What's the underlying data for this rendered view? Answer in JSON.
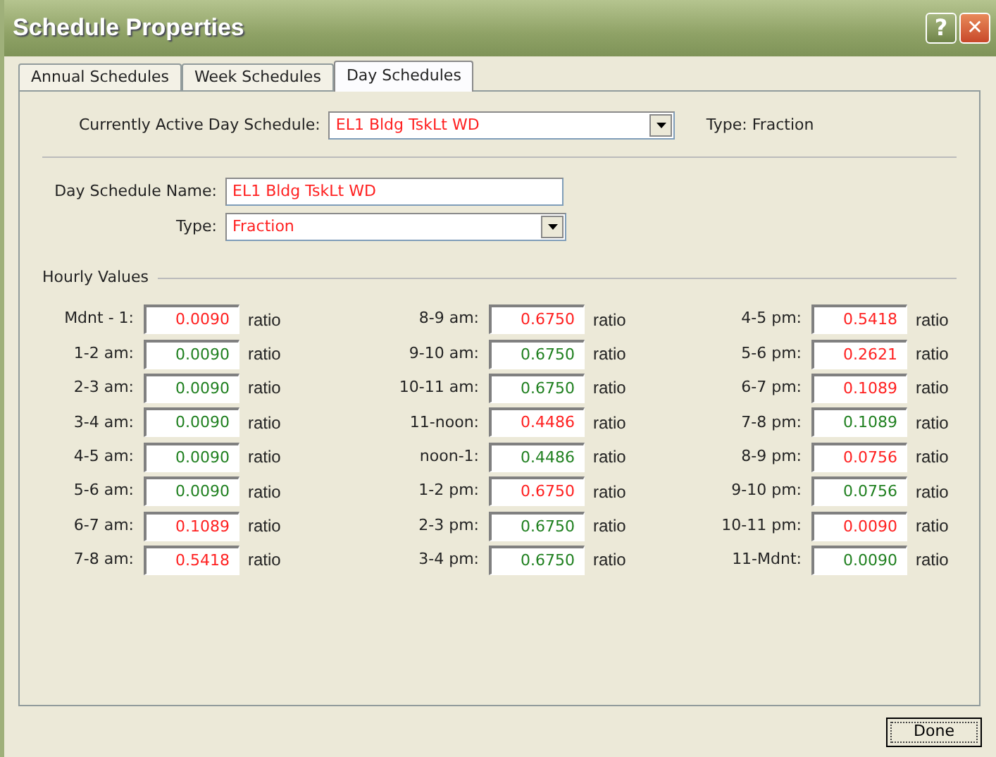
{
  "window": {
    "title": "Schedule Properties",
    "help_button": "?",
    "close_button": "✕"
  },
  "tabs": [
    {
      "label": "Annual Schedules",
      "selected": false
    },
    {
      "label": "Week Schedules",
      "selected": false
    },
    {
      "label": "Day Schedules",
      "selected": true
    }
  ],
  "active_schedule": {
    "label": "Currently Active Day Schedule:",
    "value": "EL1 Bldg TskLt WD",
    "type_text": "Type: Fraction"
  },
  "day_schedule_name": {
    "label": "Day Schedule Name:",
    "value": "EL1 Bldg TskLt WD"
  },
  "type": {
    "label": "Type:",
    "value": "Fraction"
  },
  "hourly_values": {
    "title": "Hourly Values",
    "columns": [
      [
        {
          "label": "Mdnt - 1:",
          "value": "0.0090",
          "unit": "ratio",
          "color": "#ff2020"
        },
        {
          "label": "1-2 am:",
          "value": "0.0090",
          "unit": "ratio",
          "color": "#208020"
        },
        {
          "label": "2-3 am:",
          "value": "0.0090",
          "unit": "ratio",
          "color": "#208020"
        },
        {
          "label": "3-4 am:",
          "value": "0.0090",
          "unit": "ratio",
          "color": "#208020"
        },
        {
          "label": "4-5 am:",
          "value": "0.0090",
          "unit": "ratio",
          "color": "#208020"
        },
        {
          "label": "5-6 am:",
          "value": "0.0090",
          "unit": "ratio",
          "color": "#208020"
        },
        {
          "label": "6-7 am:",
          "value": "0.1089",
          "unit": "ratio",
          "color": "#ff2020"
        },
        {
          "label": "7-8 am:",
          "value": "0.5418",
          "unit": "ratio",
          "color": "#ff2020"
        }
      ],
      [
        {
          "label": "8-9 am:",
          "value": "0.6750",
          "unit": "ratio",
          "color": "#ff2020"
        },
        {
          "label": "9-10 am:",
          "value": "0.6750",
          "unit": "ratio",
          "color": "#208020"
        },
        {
          "label": "10-11 am:",
          "value": "0.6750",
          "unit": "ratio",
          "color": "#208020"
        },
        {
          "label": "11-noon:",
          "value": "0.4486",
          "unit": "ratio",
          "color": "#ff2020"
        },
        {
          "label": "noon-1:",
          "value": "0.4486",
          "unit": "ratio",
          "color": "#208020"
        },
        {
          "label": "1-2 pm:",
          "value": "0.6750",
          "unit": "ratio",
          "color": "#ff2020"
        },
        {
          "label": "2-3 pm:",
          "value": "0.6750",
          "unit": "ratio",
          "color": "#208020"
        },
        {
          "label": "3-4 pm:",
          "value": "0.6750",
          "unit": "ratio",
          "color": "#208020"
        }
      ],
      [
        {
          "label": "4-5 pm:",
          "value": "0.5418",
          "unit": "ratio",
          "color": "#ff2020"
        },
        {
          "label": "5-6 pm:",
          "value": "0.2621",
          "unit": "ratio",
          "color": "#ff2020"
        },
        {
          "label": "6-7 pm:",
          "value": "0.1089",
          "unit": "ratio",
          "color": "#ff2020"
        },
        {
          "label": "7-8 pm:",
          "value": "0.1089",
          "unit": "ratio",
          "color": "#208020"
        },
        {
          "label": "8-9 pm:",
          "value": "0.0756",
          "unit": "ratio",
          "color": "#ff2020"
        },
        {
          "label": "9-10 pm:",
          "value": "0.0756",
          "unit": "ratio",
          "color": "#208020"
        },
        {
          "label": "10-11 pm:",
          "value": "0.0090",
          "unit": "ratio",
          "color": "#ff2020"
        },
        {
          "label": "11-Mdnt:",
          "value": "0.0090",
          "unit": "ratio",
          "color": "#208020"
        }
      ]
    ]
  },
  "buttons": [
    "Done"
  ]
}
